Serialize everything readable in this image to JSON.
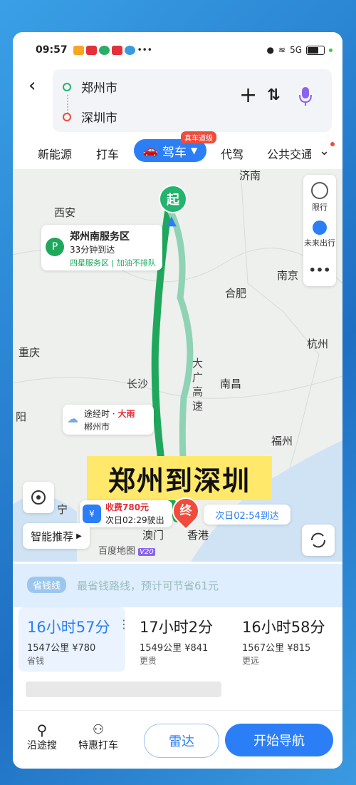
{
  "status": {
    "time": "09:57",
    "network": "5G",
    "colors": {
      "app1": "#f5a623",
      "app2": "#e5303a",
      "app3": "#e5303a"
    }
  },
  "route": {
    "from": "郑州市",
    "to": "深圳市"
  },
  "modes": {
    "items": [
      "新能源",
      "打车",
      "代驾",
      "公共交通"
    ],
    "active": "驾车",
    "active_badge": "真车道级"
  },
  "map": {
    "cities": [
      "济南",
      "西安",
      "合肥",
      "南京",
      "杭州",
      "重庆",
      "长沙",
      "南昌",
      "福州",
      "阳",
      "宁",
      "澳门",
      "香港"
    ],
    "highway": "大广高速",
    "start_label": "起",
    "end_label": "终",
    "right_panel": {
      "restrict": "限行",
      "future": "未来出行"
    },
    "service_area": {
      "name": "郑州南服务区",
      "eta": "33分钟到达",
      "desc": "四星服务区 | 加油不排队"
    },
    "weather": {
      "prefix": "途经时 · ",
      "condition": "大雨",
      "city": "郴州市"
    },
    "toll": {
      "label": "收费780元",
      "exit": "次日02:29驶出"
    },
    "arrival": "次日02:54到达",
    "smart": "智能推荐",
    "brand": "百度地图",
    "brand_ver": "V20",
    "overlay_title": "郑州到深圳"
  },
  "banner": {
    "tag": "省钱线",
    "text": "最省钱路线，预计可节省61元"
  },
  "routes": [
    {
      "time": "16小时57分",
      "info": "1547公里 ¥780",
      "tag": "省钱"
    },
    {
      "time": "17小时2分",
      "info": "1549公里 ¥841",
      "tag": "更贵"
    },
    {
      "time": "16小时58分",
      "info": "1567公里 ¥815",
      "tag": "更远"
    }
  ],
  "bottom": {
    "search": "沿途搜",
    "taxi": "特惠打车",
    "radar": "雷达",
    "nav": "开始导航"
  },
  "colors": {
    "primary": "#2b7ef6",
    "route_green": "#1fa85c",
    "alt_route": "#8fd3b4",
    "end_red": "#f04b3b"
  }
}
